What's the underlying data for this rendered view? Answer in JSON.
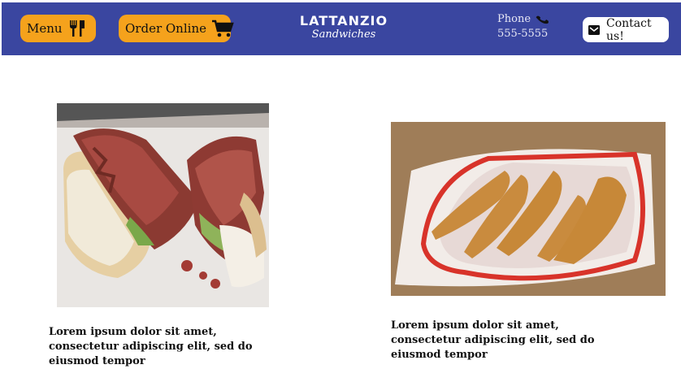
{
  "nav": {
    "menu_label": "Menu",
    "order_label": "Order Online",
    "logo_line1": "LATTANZIO",
    "logo_line2": "Sandwiches",
    "phone_label": "Phone",
    "phone_number": "555-5555",
    "contact_label": "Contact us!",
    "icons": [
      "utensils-icon",
      "cart-icon",
      "phone-icon",
      "envelope-icon"
    ]
  },
  "colors": {
    "navbar": "#3a46a0",
    "pill": "#f5a21c",
    "contact_bg": "#ffffff"
  },
  "content": {
    "items": [
      {
        "image": "sandwich-photo",
        "caption": "Lorem ipsum dolor sit amet, consectetur adipiscing elit, sed do eiusmod tempor"
      },
      {
        "image": "chicken-tenders-photo",
        "caption": "Lorem ipsum dolor sit amet, consectetur adipiscing elit, sed do eiusmod tempor"
      }
    ]
  }
}
